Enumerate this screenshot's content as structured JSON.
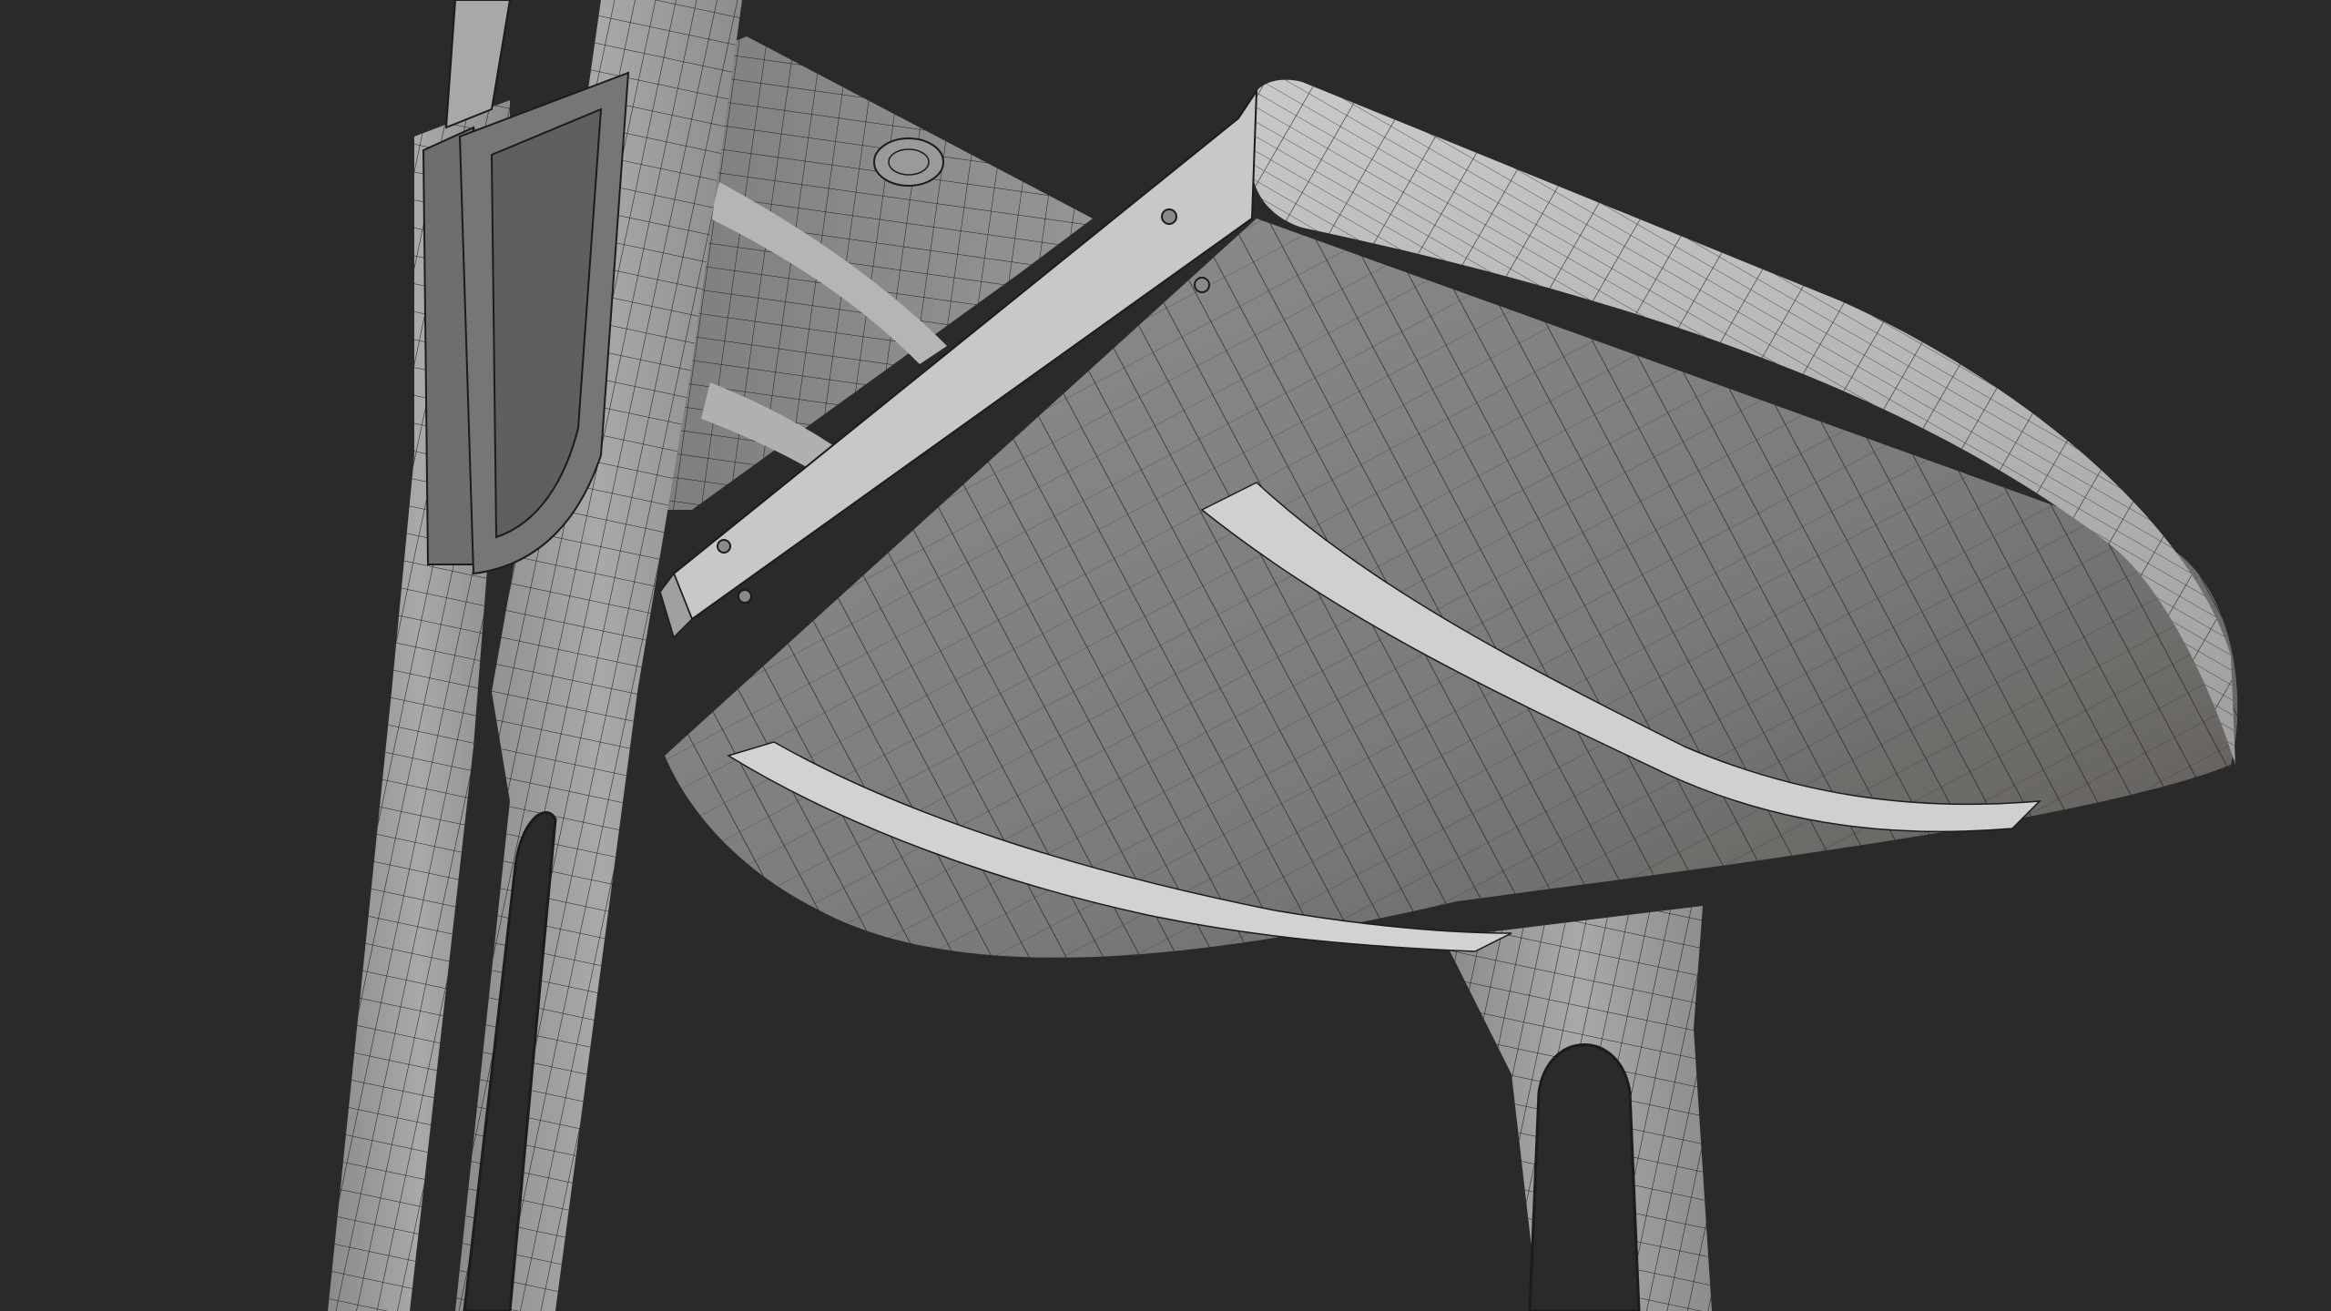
{
  "viewport": {
    "background_color": "#2a2a2a",
    "mode": "3d-viewport-wireframe-overlay"
  },
  "model": {
    "subject": "chair",
    "parts": [
      "seat",
      "seat-edge-band",
      "front-apron",
      "back-leg-left",
      "back-leg-right",
      "backrest",
      "front-leg"
    ],
    "surface_colors": {
      "light": "#cfcfcf",
      "mid": "#9a9a9a",
      "dark": "#6c6c6c",
      "wire": "#1c1c1c"
    }
  }
}
